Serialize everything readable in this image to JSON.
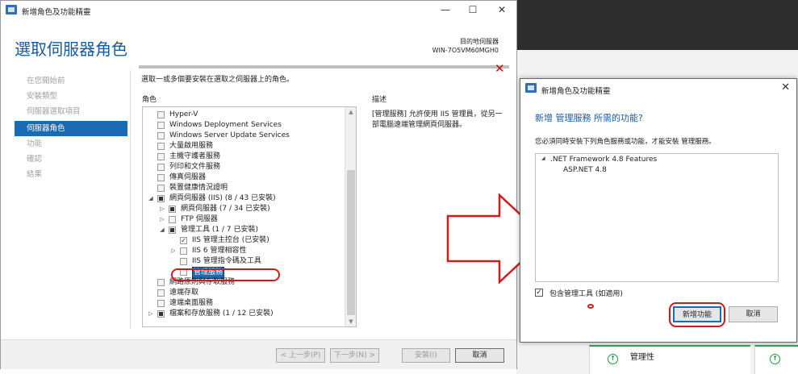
{
  "wizard": {
    "title": "新增角色及功能精靈",
    "window_controls": {
      "minimize": "—",
      "maximize": "☐",
      "close": "✕"
    },
    "page_title": "選取伺服器角色",
    "destination_label": "目的地伺服器",
    "destination_server": "WIN-7O5VM60MGH0",
    "error_mark": "✕",
    "nav": [
      {
        "label": "在您開始前",
        "active": false
      },
      {
        "label": "安裝類型",
        "active": false
      },
      {
        "label": "伺服器選取項目",
        "active": false
      },
      {
        "label": "伺服器角色",
        "active": true
      },
      {
        "label": "功能",
        "active": false
      },
      {
        "label": "確認",
        "active": false
      },
      {
        "label": "結果",
        "active": false
      }
    ],
    "instruction": "選取一或多個要安裝在選取之伺服器上的角色。",
    "roles_header": "角色",
    "desc_header": "描述",
    "roles": [
      {
        "label": "Hyper-V",
        "level": 0,
        "expander": "",
        "state": "none"
      },
      {
        "label": "Windows Deployment Services",
        "level": 0,
        "expander": "",
        "state": "none"
      },
      {
        "label": "Windows Server Update Services",
        "level": 0,
        "expander": "",
        "state": "none"
      },
      {
        "label": "大量啟用服務",
        "level": 0,
        "expander": "",
        "state": "none"
      },
      {
        "label": "主機守護者服務",
        "level": 0,
        "expander": "",
        "state": "none"
      },
      {
        "label": "列印和文件服務",
        "level": 0,
        "expander": "",
        "state": "none"
      },
      {
        "label": "傳真伺服器",
        "level": 0,
        "expander": "",
        "state": "none"
      },
      {
        "label": "裝置健康情況證明",
        "level": 0,
        "expander": "",
        "state": "none"
      },
      {
        "label": "網頁伺服器 (IIS) (8 / 43 已安裝)",
        "level": 0,
        "expander": "◢",
        "state": "partial"
      },
      {
        "label": "網頁伺服器 (7 / 34 已安裝)",
        "level": 1,
        "expander": "▷",
        "state": "partial"
      },
      {
        "label": "FTP 伺服器",
        "level": 1,
        "expander": "▷",
        "state": "none"
      },
      {
        "label": "管理工具 (1 / 7 已安裝)",
        "level": 1,
        "expander": "◢",
        "state": "partial"
      },
      {
        "label": "IIS 管理主控台 (已安裝)",
        "level": 2,
        "expander": "",
        "state": "checked"
      },
      {
        "label": "IIS 6 管理相容性",
        "level": 2,
        "expander": "▷",
        "state": "none"
      },
      {
        "label": "IIS 管理指令碼及工具",
        "level": 2,
        "expander": "",
        "state": "none"
      },
      {
        "label": "管理服務",
        "level": 2,
        "expander": "",
        "state": "selected"
      },
      {
        "label": "網路原則與存取服務",
        "level": 0,
        "expander": "",
        "state": "none"
      },
      {
        "label": "遠端存取",
        "level": 0,
        "expander": "",
        "state": "none"
      },
      {
        "label": "遠端桌面服務",
        "level": 0,
        "expander": "",
        "state": "none"
      },
      {
        "label": "檔案和存放服務 (1 / 12 已安裝)",
        "level": 0,
        "expander": "▷",
        "state": "partial"
      }
    ],
    "description": "[管理服務] 允許使用 IIS 管理員，從另一部電腦遠端管理網頁伺服器。",
    "buttons": {
      "prev": "< 上一步(P)",
      "next": "下一步(N) >",
      "install": "安裝(I)",
      "cancel": "取消"
    }
  },
  "dialog": {
    "title": "新增角色及功能精靈",
    "close": "✕",
    "heading": "新增 管理服務 所需的功能?",
    "subtext": "您必須同時安裝下列角色服務或功能，才能安裝 管理服務。",
    "features": [
      {
        "label": ".NET Framework 4.8 Features",
        "expander": "◢"
      },
      {
        "label": "ASP.NET 4.8",
        "expander": ""
      }
    ],
    "include_tools_label": "包含管理工具 (如適用)",
    "include_tools_checked": true,
    "add_button": "新增功能",
    "cancel_button": "取消"
  },
  "background": {
    "tile_label": "管理性"
  },
  "colors": {
    "accent": "#1a6ab4",
    "title_blue": "#1a5a9e",
    "annotation_red": "#d11a1a",
    "ok_green": "#1e9a3e"
  }
}
